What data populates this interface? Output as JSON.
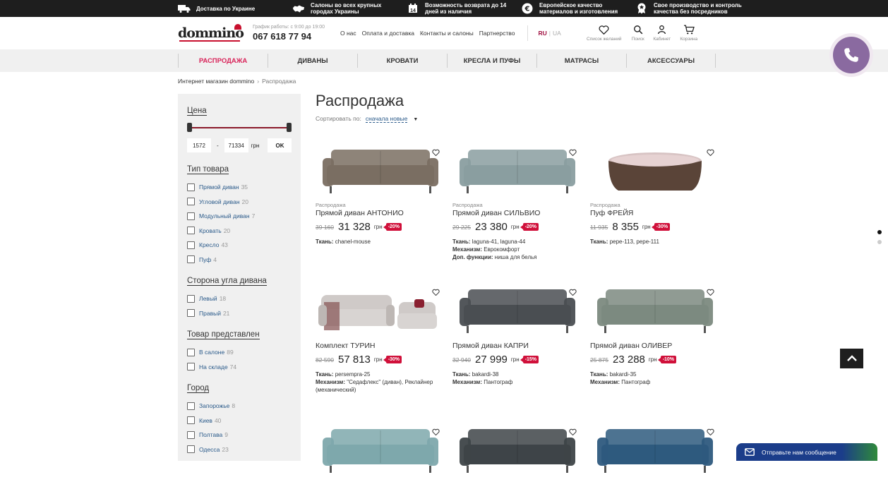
{
  "topbar": {
    "features": [
      {
        "icon": "truck-icon",
        "text1": "Доставка по Украине",
        "text2": ""
      },
      {
        "icon": "ukraine-map-icon",
        "text1": "Салоны во всех крупных",
        "text2": "городах Украины"
      },
      {
        "icon": "calendar-icon",
        "text1": "Возможность возврата до 14",
        "text2": "дней из наличия"
      },
      {
        "icon": "euro-icon",
        "text1": "Европейское качество",
        "text2": "материалов и изготовления"
      },
      {
        "icon": "award-icon",
        "text1": "Свое производство и контроль",
        "text2": "качества без посредников"
      }
    ]
  },
  "header": {
    "logo_text": "dommino",
    "hours": "График работы: с 9:00 до 19:00",
    "phone": "067 618 77 94",
    "links": [
      "О нас",
      "Оплата и доставка",
      "Контакты и салоны",
      "Партнерство"
    ],
    "lang_ru": "RU",
    "lang_ua": "UA",
    "icons": [
      {
        "name": "wishlist",
        "label": "Список желаний"
      },
      {
        "name": "search",
        "label": "Поиск"
      },
      {
        "name": "cabinet",
        "label": "Кабинет"
      },
      {
        "name": "cart",
        "label": "Корзина"
      }
    ]
  },
  "categories": [
    "РАСПРОДАЖА",
    "ДИВАНЫ",
    "КРОВАТИ",
    "КРЕСЛА И ПУФЫ",
    "МАТРАСЫ",
    "АКСЕССУАРЫ"
  ],
  "breadcrumb": {
    "home": "Интернет магазин dommino",
    "current": "Распродажа"
  },
  "filters": {
    "price_title": "Цена",
    "price_min": "1572",
    "price_max": "71334",
    "currency": "грн",
    "ok": "OK",
    "groups": [
      {
        "title": "Тип товара",
        "options": [
          {
            "label": "Прямой диван",
            "count": "35"
          },
          {
            "label": "Угловой диван",
            "count": "20"
          },
          {
            "label": "Модульный диван",
            "count": "7"
          },
          {
            "label": "Кровать",
            "count": "20"
          },
          {
            "label": "Кресло",
            "count": "43"
          },
          {
            "label": "Пуф",
            "count": "4"
          }
        ]
      },
      {
        "title": "Сторона угла дивана",
        "options": [
          {
            "label": "Левый",
            "count": "18"
          },
          {
            "label": "Правый",
            "count": "21"
          }
        ]
      },
      {
        "title": "Товар представлен",
        "options": [
          {
            "label": "В салоне",
            "count": "89"
          },
          {
            "label": "На складе",
            "count": "74"
          }
        ]
      },
      {
        "title": "Город",
        "options": [
          {
            "label": "Запорожье",
            "count": "8"
          },
          {
            "label": "Киев",
            "count": "40"
          },
          {
            "label": "Полтава",
            "count": "9"
          },
          {
            "label": "Одесса",
            "count": "23"
          }
        ]
      }
    ]
  },
  "page_title": "Распродажа",
  "sort": {
    "label": "Сортировать по:",
    "value": "сначала новые"
  },
  "products": [
    {
      "category": "Распродажа",
      "name": "Прямой диван АНТОНИО",
      "old_price": "39 160",
      "price": "31 328",
      "currency": "грн",
      "discount": "-20%",
      "attrs": [
        {
          "k": "Ткань:",
          "v": "chanel-mouse"
        }
      ],
      "color": "#7a6e62"
    },
    {
      "category": "Распродажа",
      "name": "Прямой диван СИЛЬВИО",
      "old_price": "29 225",
      "price": "23 380",
      "currency": "грн",
      "discount": "-20%",
      "attrs": [
        {
          "k": "Ткань:",
          "v": "laguna-41, laguna-44"
        },
        {
          "k": "Механизм:",
          "v": "Еврокомфорт"
        },
        {
          "k": "Доп. функции:",
          "v": "ниша для белья"
        }
      ],
      "color": "#8a9ea0"
    },
    {
      "category": "Распродажа",
      "name": "Пуф ФРЕЙЯ",
      "old_price": "11 935",
      "price": "8 355",
      "currency": "грн",
      "discount": "-30%",
      "attrs": [
        {
          "k": "Ткань:",
          "v": "pepe-113, pepe-111"
        }
      ],
      "color": "#5a4438"
    },
    {
      "category": "",
      "name": "Комплект ТУРИН",
      "old_price": "82 590",
      "price": "57 813",
      "currency": "грн",
      "discount": "-30%",
      "attrs": [
        {
          "k": "Ткань:",
          "v": "persempra-25"
        },
        {
          "k": "Механизм:",
          "v": "\"Седафлекс\" (диван), Реклайнер (механический)"
        }
      ],
      "color": "#d8d4d2"
    },
    {
      "category": "",
      "name": "Прямой диван КАПРИ",
      "old_price": "32 940",
      "price": "27 999",
      "currency": "грн",
      "discount": "-15%",
      "attrs": [
        {
          "k": "Ткань:",
          "v": "bakardi-38"
        },
        {
          "k": "Механизм:",
          "v": "Пантограф"
        }
      ],
      "color": "#4a4e52"
    },
    {
      "category": "",
      "name": "Прямой диван ОЛИВЕР",
      "old_price": "25 875",
      "price": "23 288",
      "currency": "грн",
      "discount": "-10%",
      "attrs": [
        {
          "k": "Ткань:",
          "v": "bakardi-35"
        },
        {
          "k": "Механизм:",
          "v": "Пантограф"
        }
      ],
      "color": "#7c8a80"
    },
    {
      "category": "",
      "name": "",
      "old_price": "",
      "price": "",
      "currency": "",
      "discount": "",
      "attrs": [],
      "color": "#7ea8ac"
    },
    {
      "category": "",
      "name": "",
      "old_price": "",
      "price": "",
      "currency": "",
      "discount": "",
      "attrs": [],
      "color": "#3e4448"
    },
    {
      "category": "",
      "name": "",
      "old_price": "",
      "price": "",
      "currency": "",
      "discount": "",
      "attrs": [],
      "color": "#2e5a7e"
    }
  ],
  "message_button": "Отправьте нам сообщение"
}
